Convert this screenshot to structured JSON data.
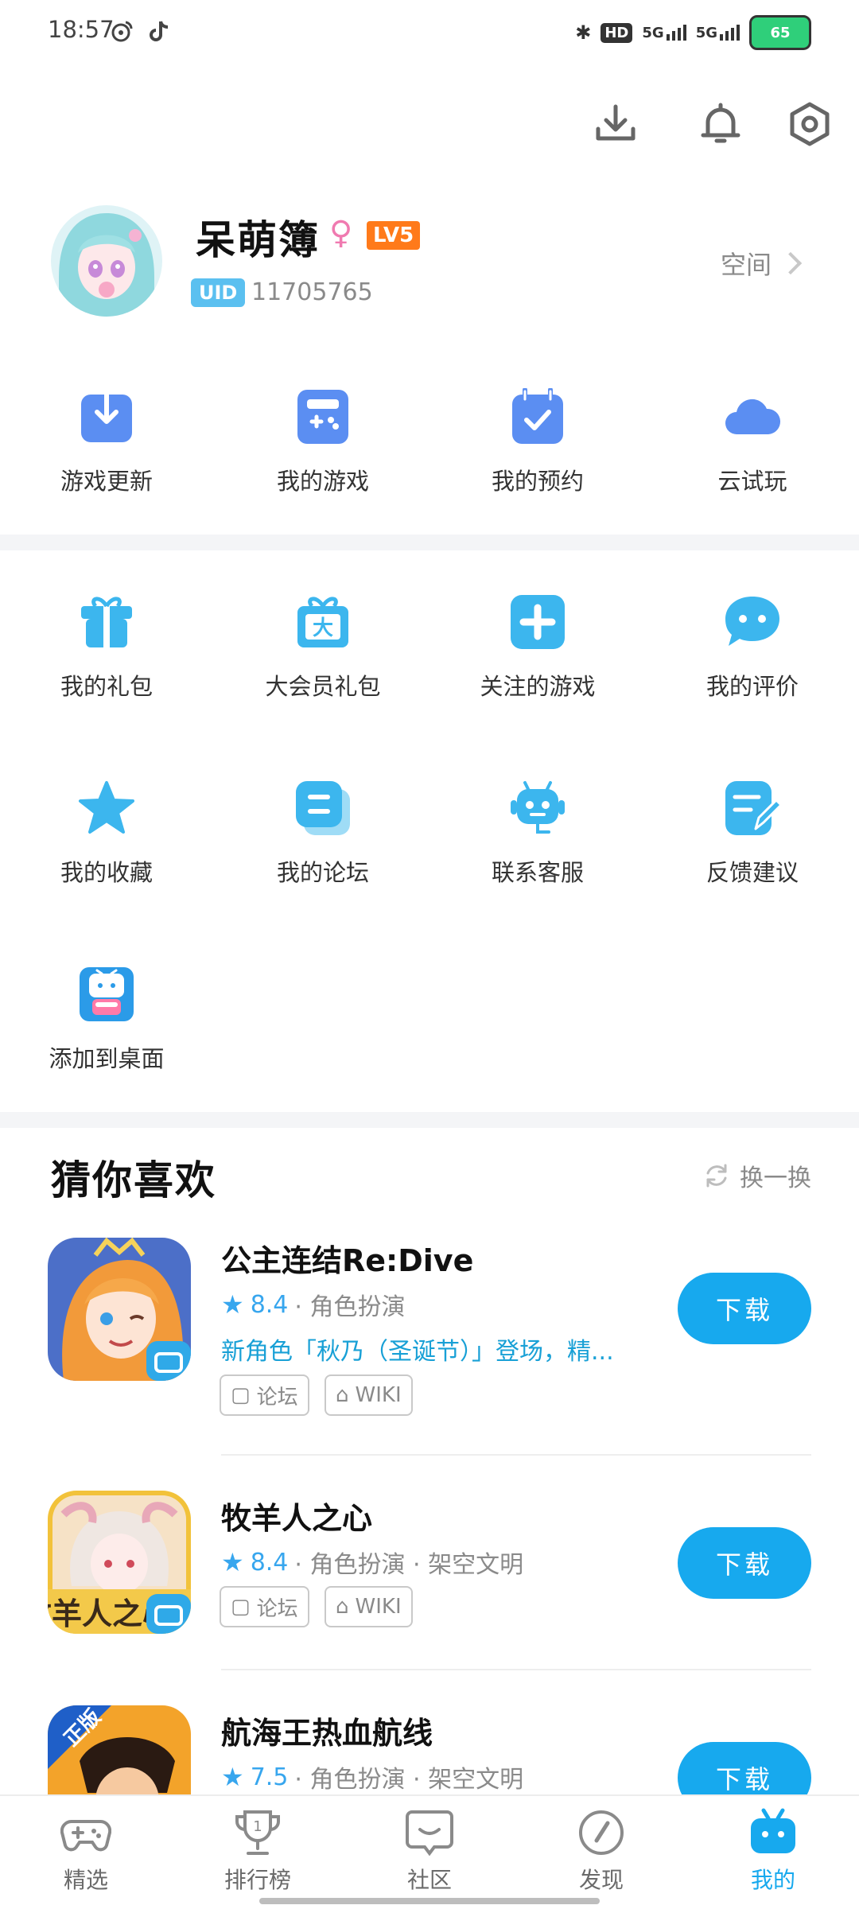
{
  "status": {
    "time": "18:57",
    "hd_label": "HD",
    "net1": "5G",
    "net2": "5G",
    "battery": "65"
  },
  "header": {
    "icons": [
      "download-icon",
      "bell-icon",
      "settings-icon"
    ]
  },
  "profile": {
    "username": "呆萌簿",
    "gender": "♀",
    "level": "LV5",
    "uid_label": "UID",
    "uid_value": "11705765",
    "space_label": "空间"
  },
  "quick_actions": [
    {
      "label": "游戏更新",
      "icon": "download-box-icon"
    },
    {
      "label": "我的游戏",
      "icon": "gamepad-icon"
    },
    {
      "label": "我的预约",
      "icon": "calendar-check-icon"
    },
    {
      "label": "云试玩",
      "icon": "cloud-icon"
    }
  ],
  "services": [
    {
      "label": "我的礼包",
      "icon": "gift-icon"
    },
    {
      "label": "大会员礼包",
      "icon": "vip-gift-icon"
    },
    {
      "label": "关注的游戏",
      "icon": "plus-icon"
    },
    {
      "label": "我的评价",
      "icon": "comment-icon"
    },
    {
      "label": "我的收藏",
      "icon": "star-icon"
    },
    {
      "label": "我的论坛",
      "icon": "forum-icon"
    },
    {
      "label": "联系客服",
      "icon": "robot-icon"
    },
    {
      "label": "反馈建议",
      "icon": "edit-icon"
    },
    {
      "label": "添加到桌面",
      "icon": "bilibili-desktop-icon"
    }
  ],
  "recommend": {
    "title": "猜你喜欢",
    "refresh_label": "换一换",
    "games": [
      {
        "name": "公主连结Re:Dive",
        "rating": "8.4",
        "category": "· 角色扮演",
        "news": "新角色「秋乃（圣诞节）」登场，精...",
        "tags": [
          "论坛",
          "WIKI"
        ],
        "button": "下载"
      },
      {
        "name": "牧羊人之心",
        "rating": "8.4",
        "category": "· 角色扮演 · 架空文明",
        "tags": [
          "论坛",
          "WIKI"
        ],
        "button": "下载",
        "icon_text": "牧羊人之心"
      },
      {
        "name": "航海王热血航线",
        "rating": "7.5",
        "category": "· 角色扮演 · 架空文明",
        "button": "下载",
        "icon_text": "正版"
      }
    ]
  },
  "bottom_nav": [
    {
      "label": "精选",
      "icon": "gamepad-nav-icon",
      "active": false
    },
    {
      "label": "排行榜",
      "icon": "trophy-icon",
      "active": false
    },
    {
      "label": "社区",
      "icon": "community-icon",
      "active": false
    },
    {
      "label": "发现",
      "icon": "compass-icon",
      "active": false
    },
    {
      "label": "我的",
      "icon": "bilibili-tv-icon",
      "active": true
    }
  ],
  "colors": {
    "accent": "#17a9ee",
    "quick_icon": "#5b8ef2",
    "service_icon": "#3cb6ee"
  }
}
